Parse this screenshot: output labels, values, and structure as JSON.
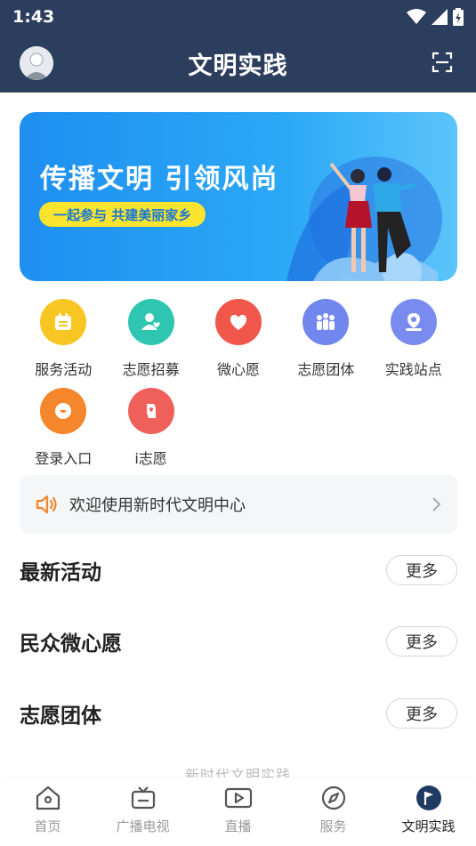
{
  "status_bar": {
    "time": "1:43"
  },
  "header": {
    "title": "文明实践"
  },
  "banner": {
    "headline": "传播文明 引领风尚",
    "subline": "一起参与 共建美丽家乡"
  },
  "grid": {
    "items": [
      {
        "label": "服务活动",
        "color": "#f8c623",
        "icon": "calendar-icon"
      },
      {
        "label": "志愿招募",
        "color": "#2ec6b0",
        "icon": "person-heart-icon"
      },
      {
        "label": "微心愿",
        "color": "#f0574a",
        "icon": "heart-icon"
      },
      {
        "label": "志愿团体",
        "color": "#7187ee",
        "icon": "group-icon"
      },
      {
        "label": "实践站点",
        "color": "#7a8bf0",
        "icon": "location-icon"
      },
      {
        "label": "登录入口",
        "color": "#f5862b",
        "icon": "login-icon"
      },
      {
        "label": "i志愿",
        "color": "#f0605a",
        "icon": "hand-icon"
      }
    ]
  },
  "notice": {
    "text": "欢迎使用新时代文明中心"
  },
  "sections": [
    {
      "title": "最新活动",
      "more": "更多"
    },
    {
      "title": "民众微心愿",
      "more": "更多"
    },
    {
      "title": "志愿团体",
      "more": "更多"
    }
  ],
  "footer_text": "新时代文明实践",
  "tabbar": {
    "tabs": [
      {
        "label": "首页",
        "icon": "home-icon",
        "active": false
      },
      {
        "label": "广播电视",
        "icon": "tv-icon",
        "active": false
      },
      {
        "label": "直播",
        "icon": "video-icon",
        "active": false
      },
      {
        "label": "服务",
        "icon": "compass-icon",
        "active": false
      },
      {
        "label": "文明实践",
        "icon": "flag-icon",
        "active": true
      }
    ]
  },
  "colors": {
    "header_bg": "#2c3e5d",
    "banner_blue": "#1f8ff0",
    "pill_yellow": "#fbe42e",
    "notice_speaker": "#f5862b"
  }
}
